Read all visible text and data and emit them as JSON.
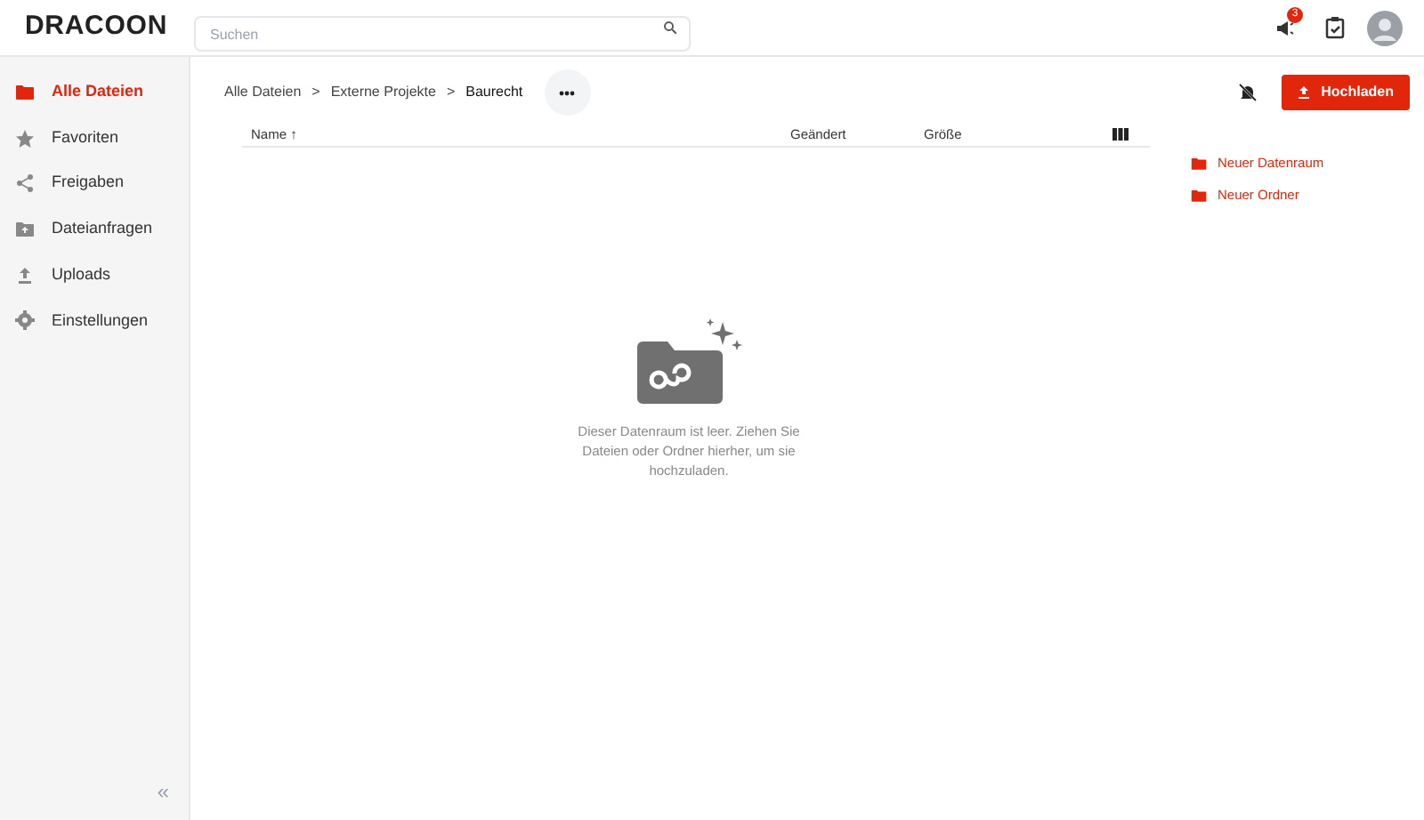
{
  "header": {
    "logo": "DRACOON",
    "search": {
      "placeholder": "Suchen"
    },
    "notification_badge": "3"
  },
  "sidebar": {
    "items": [
      {
        "label": "Alle Dateien",
        "selected": true
      },
      {
        "label": "Favoriten",
        "selected": false
      },
      {
        "label": "Freigaben",
        "selected": false
      },
      {
        "label": "Dateianfragen",
        "selected": false
      },
      {
        "label": "Uploads",
        "selected": false
      },
      {
        "label": "Einstellungen",
        "selected": false
      }
    ],
    "collapse": "«"
  },
  "breadcrumbs": [
    "Alle Dateien",
    "Externe Projekte",
    "Baurecht"
  ],
  "breadcrumb_separator": ">",
  "table": {
    "columns": [
      "Name ↑",
      "Geändert",
      "Größe"
    ]
  },
  "empty_state": "Dieser Datenraum ist leer. Ziehen Sie Dateien oder Ordner hierher, um sie hochzuladen.",
  "upload_button": "Hochladen",
  "actions": [
    "Neuer Datenraum",
    "Neuer Ordner"
  ]
}
